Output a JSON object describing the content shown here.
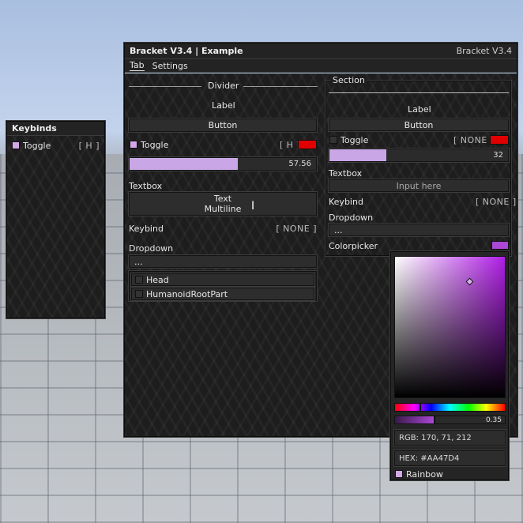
{
  "keybinds_window": {
    "title": "Keybinds",
    "items": [
      {
        "label": "Toggle",
        "key": "[ H ]",
        "enabled": true
      }
    ]
  },
  "main_window": {
    "title": "Bracket V3.4 | Example",
    "version": "Bracket V3.4",
    "tabs": [
      {
        "label": "Tab",
        "active": true
      },
      {
        "label": "Settings",
        "active": false
      }
    ],
    "left": {
      "divider_label": "Divider",
      "label_text": "Label",
      "button_label": "Button",
      "toggle_label": "Toggle",
      "toggle_key": "[ H ]",
      "toggle_color": "#E00000",
      "slider_value": "57.56",
      "slider_fraction": 0.58,
      "textbox_label": "Textbox",
      "textbox_line1": "Text",
      "textbox_line2": "Multiline",
      "keybind_label": "Keybind",
      "keybind_value": "[ NONE ]",
      "dropdown_label": "Dropdown",
      "dropdown_value": "...",
      "dropdown_options": [
        {
          "label": "Head"
        },
        {
          "label": "HumanoidRootPart"
        }
      ]
    },
    "right": {
      "section_label": "Section",
      "label_text": "Label",
      "button_label": "Button",
      "toggle_label": "Toggle",
      "toggle_key": "[ NONE ]",
      "toggle_color": "#E00000",
      "slider_value": "32",
      "slider_fraction": 0.32,
      "textbox_label": "Textbox",
      "textbox_placeholder": "Input here",
      "keybind_label": "Keybind",
      "keybind_value": "[ NONE ]",
      "dropdown_label": "Dropdown",
      "dropdown_value": "...",
      "colorpicker_label": "Colorpicker",
      "colorpicker_color": "#AA47D4"
    }
  },
  "color_picker": {
    "alpha_value": "0.35",
    "alpha_fraction": 0.35,
    "hue_fraction": 0.79,
    "rgb_text": "RGB: 170, 71, 212",
    "hex_text": "HEX: #AA47D4",
    "rainbow_label": "Rainbow",
    "rainbow_enabled": true,
    "hue_color": "#B01EE6"
  }
}
